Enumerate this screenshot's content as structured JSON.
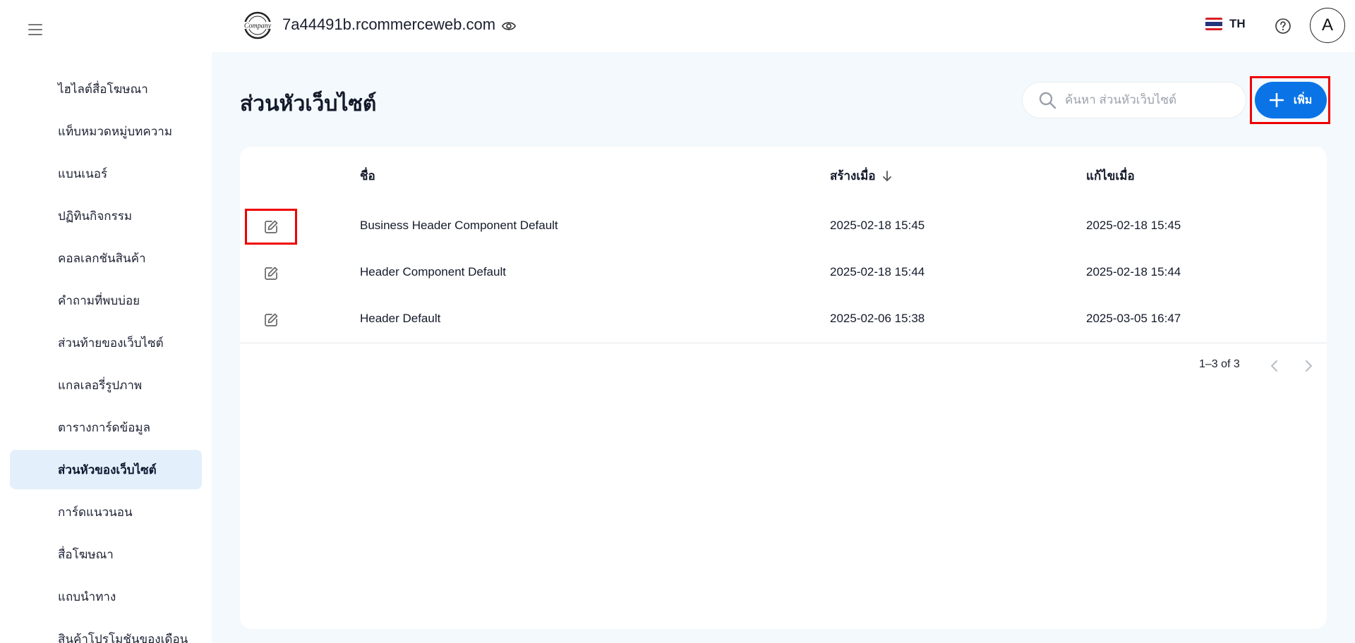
{
  "site": {
    "domain": "7a44491b.rcommerceweb.com",
    "logo_text": "Company"
  },
  "header": {
    "language": "TH",
    "avatar_initial": "A"
  },
  "sidebar": {
    "items": [
      {
        "label": "ไฮไลต์สื่อโฆษณา",
        "active": false
      },
      {
        "label": "แท็บหมวดหมู่บทความ",
        "active": false
      },
      {
        "label": "แบนเนอร์",
        "active": false
      },
      {
        "label": "ปฏิทินกิจกรรม",
        "active": false
      },
      {
        "label": "คอลเลกชันสินค้า",
        "active": false
      },
      {
        "label": "คำถามที่พบบ่อย",
        "active": false
      },
      {
        "label": "ส่วนท้ายของเว็บไซต์",
        "active": false
      },
      {
        "label": "แกลเลอรี่รูปภาพ",
        "active": false
      },
      {
        "label": "ตารางการ์ดข้อมูล",
        "active": false
      },
      {
        "label": "ส่วนหัวของเว็บไซต์",
        "active": true
      },
      {
        "label": "การ์ดแนวนอน",
        "active": false
      },
      {
        "label": "สื่อโฆษณา",
        "active": false
      },
      {
        "label": "แถบนำทาง",
        "active": false
      },
      {
        "label": "สินค้าโปรโมชันของเดือน",
        "active": false
      }
    ]
  },
  "main": {
    "title": "ส่วนหัวเว็บไซต์",
    "search_placeholder": "ค้นหา ส่วนหัวเว็บไซต์",
    "add_label": "เพิ่ม",
    "columns": {
      "name": "ชื่อ",
      "created": "สร้างเมื่อ",
      "updated": "แก้ไขเมื่อ"
    },
    "rows": [
      {
        "name": "Business Header Component Default",
        "created": "2025-02-18 15:45",
        "updated": "2025-02-18 15:45"
      },
      {
        "name": "Header Component Default",
        "created": "2025-02-18 15:44",
        "updated": "2025-02-18 15:44"
      },
      {
        "name": "Header Default",
        "created": "2025-02-06 15:38",
        "updated": "2025-03-05 16:47"
      }
    ],
    "pagination": "1–3 of 3"
  },
  "colors": {
    "accent": "#0a74e6",
    "active_bg": "#e3f0fb",
    "highlight": "#ee0000",
    "page_bg": "#f3f9fc"
  },
  "icons": [
    "menu-icon",
    "company-logo",
    "eye-icon",
    "thai-flag-icon",
    "help-icon",
    "search-icon",
    "plus-icon",
    "sort-down-icon",
    "edit-icon",
    "chevron-left-icon",
    "chevron-right-icon"
  ]
}
